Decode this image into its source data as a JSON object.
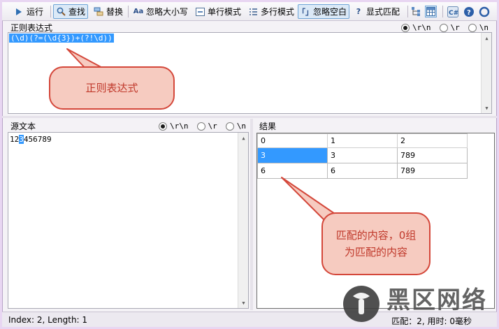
{
  "toolbar": {
    "run": "运行",
    "find": "查找",
    "replace": "替换",
    "ignore_case": "忽略大小写",
    "single_line": "单行模式",
    "multi_line": "多行模式",
    "ignore_whitespace": "忽略空白",
    "explicit_capture": "显式匹配"
  },
  "regex_panel": {
    "title": "正则表达式",
    "line_endings": [
      "\\r\\n",
      "\\r",
      "\\n"
    ],
    "selected_line_ending": "\\r\\n",
    "pattern": "(\\d)(?=(\\d{3})+(?!\\d))"
  },
  "source_panel": {
    "title": "源文本",
    "line_endings": [
      "\\r\\n",
      "\\r",
      "\\n"
    ],
    "selected_line_ending": "\\r\\n",
    "text_before": "12",
    "text_highlight": "3",
    "text_after": "456789"
  },
  "results_panel": {
    "title": "结果",
    "columns": [
      "0",
      "1",
      "2"
    ],
    "rows": [
      [
        "3",
        "3",
        "789"
      ],
      [
        "6",
        "6",
        "789"
      ]
    ]
  },
  "status": {
    "left": "Index: 2, Length: 1",
    "right": "匹配：2, 用时: 0毫秒"
  },
  "annotations": {
    "regex_callout": "正则表达式",
    "result_callout": "匹配的内容，0组为匹配的内容"
  },
  "watermark": {
    "text": "黑区网络"
  },
  "colors": {
    "selection": "#3399ff",
    "callout_fill": "#f6cbc0",
    "callout_border": "#d4473a",
    "frame": "#e8d6f2"
  }
}
